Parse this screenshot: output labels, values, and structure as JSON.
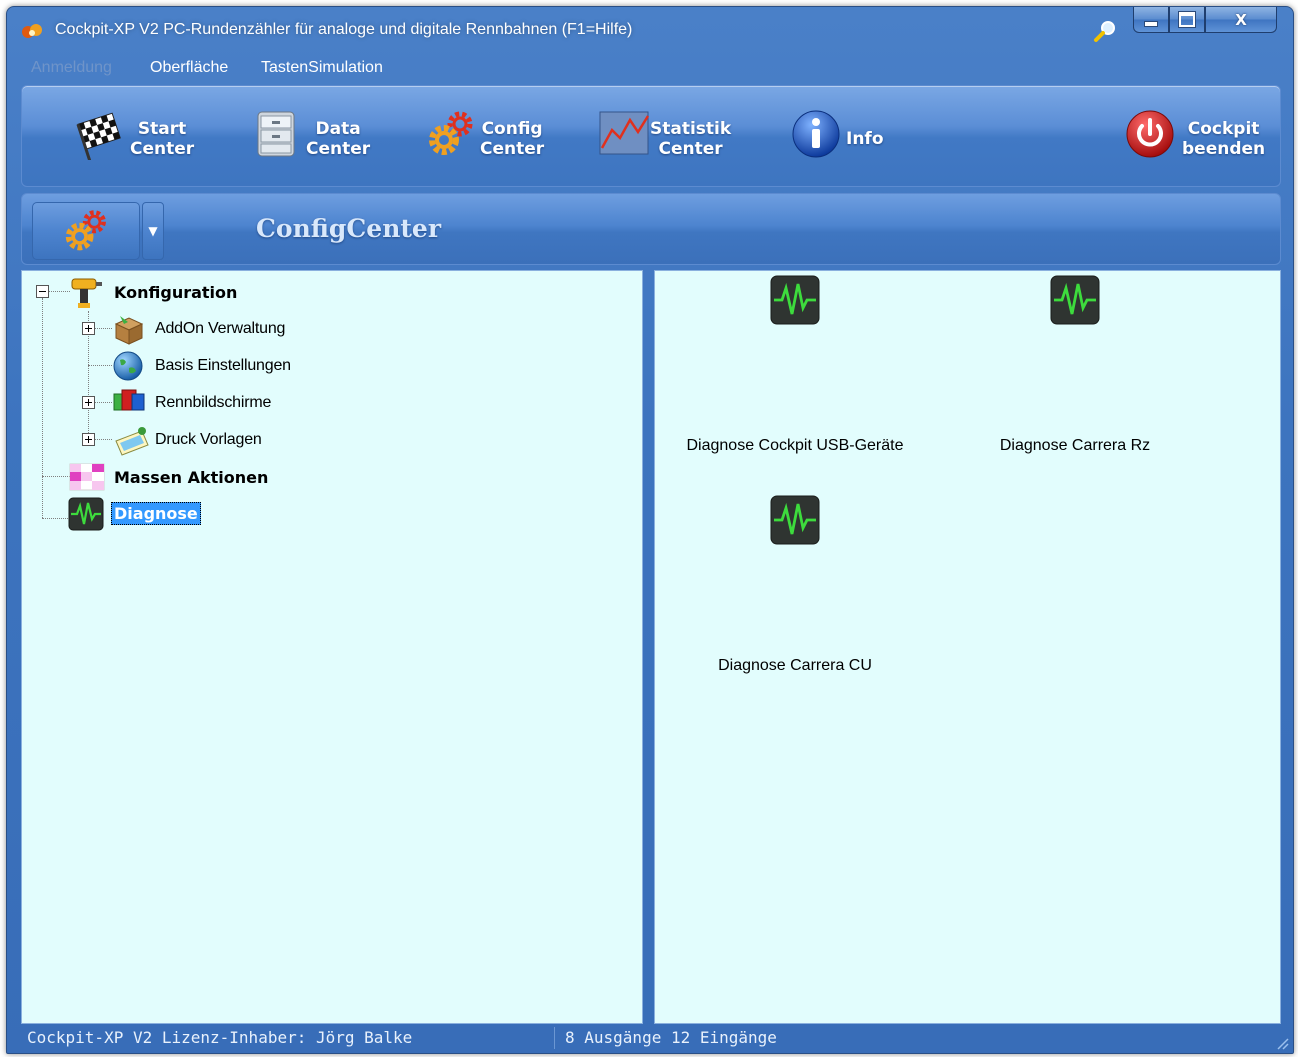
{
  "window": {
    "title": "Cockpit-XP V2 PC-Rundenzähler für analoge und digitale Rennbahnen (F1=Hilfe)"
  },
  "menu": {
    "items": [
      {
        "label": "Anmeldung",
        "enabled": false
      },
      {
        "label": "Oberfläche",
        "enabled": true
      },
      {
        "label": "TastenSimulation",
        "enabled": true
      }
    ]
  },
  "toolbar": {
    "buttons": [
      {
        "line1": "Start",
        "line2": "Center",
        "icon": "checkered-flag-icon"
      },
      {
        "line1": "Data",
        "line2": "Center",
        "icon": "database-icon"
      },
      {
        "line1": "Config",
        "line2": "Center",
        "icon": "gears-icon"
      },
      {
        "line1": "Statistik",
        "line2": "Center",
        "icon": "chart-icon"
      },
      {
        "line1": "Info",
        "line2": "",
        "icon": "info-icon"
      },
      {
        "line1": "Cockpit",
        "line2": "beenden",
        "icon": "power-icon"
      }
    ]
  },
  "header": {
    "title": "ConfigCenter"
  },
  "tree": {
    "items": [
      {
        "label": "Konfiguration",
        "bold": true,
        "icon": "drill-icon",
        "expander": "minus"
      },
      {
        "label": "AddOn Verwaltung",
        "bold": false,
        "icon": "box-icon",
        "expander": "plus"
      },
      {
        "label": "Basis Einstellungen",
        "bold": false,
        "icon": "globe-icon",
        "expander": ""
      },
      {
        "label": "Rennbildschirme",
        "bold": false,
        "icon": "screens-icon",
        "expander": "plus"
      },
      {
        "label": "Druck Vorlagen",
        "bold": false,
        "icon": "print-template-icon",
        "expander": "plus"
      },
      {
        "label": "Massen Aktionen",
        "bold": true,
        "icon": "mass-actions-icon",
        "expander": ""
      },
      {
        "label": "Diagnose",
        "bold": true,
        "icon": "diagnose-icon",
        "expander": "",
        "selected": true
      }
    ]
  },
  "tiles": [
    {
      "label": "Diagnose Cockpit USB-Geräte",
      "icon": "diagnose-icon"
    },
    {
      "label": "Diagnose Carrera Rz",
      "icon": "diagnose-icon"
    },
    {
      "label": "Diagnose Carrera CU",
      "icon": "diagnose-icon"
    }
  ],
  "status": {
    "left": "Cockpit-XP V2 Lizenz-Inhaber: Jörg Balke",
    "right": "8 Ausgänge 12 Eingänge"
  },
  "colors": {
    "window_blue": "#3d74bf",
    "panel_bg": "#e2fdfd",
    "selection": "#3399ff",
    "diagnose_green": "#3ddc3d"
  }
}
